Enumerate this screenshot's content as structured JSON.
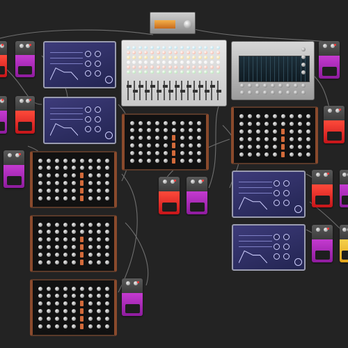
{
  "workspace": {
    "background": "#232323",
    "cable_color": "#7a7a7a"
  },
  "colors": {
    "pedal_magenta": "#b21fbf",
    "pedal_red": "#e1221f",
    "pedal_yellow": "#f1c21b",
    "pedal_teal": "#1bb6c9",
    "wood": "#8a4a2c",
    "synth_purple": "#3d3b7a",
    "display_orange": "#f0a040"
  },
  "devices": {
    "top_unit": {
      "title": "",
      "icon": "amp-unit-icon"
    },
    "pedals": [
      {
        "id": "pedal-1",
        "color": "red",
        "label": ""
      },
      {
        "id": "pedal-2",
        "color": "magenta",
        "label": ""
      },
      {
        "id": "pedal-3",
        "color": "magenta",
        "label": ""
      },
      {
        "id": "pedal-4",
        "color": "red",
        "label": ""
      },
      {
        "id": "pedal-5",
        "color": "magenta",
        "label": ""
      },
      {
        "id": "pedal-6",
        "color": "red",
        "label": ""
      },
      {
        "id": "pedal-7",
        "color": "magenta",
        "label": ""
      },
      {
        "id": "pedal-8",
        "color": "magenta",
        "label": ""
      },
      {
        "id": "pedal-9",
        "color": "magenta",
        "label": ""
      },
      {
        "id": "pedal-10",
        "color": "red",
        "label": ""
      },
      {
        "id": "pedal-11",
        "color": "red",
        "label": ""
      },
      {
        "id": "pedal-12",
        "color": "magenta",
        "label": ""
      },
      {
        "id": "pedal-13",
        "color": "magenta",
        "label": ""
      },
      {
        "id": "pedal-14",
        "color": "yellow",
        "label": ""
      }
    ],
    "synths": [
      {
        "id": "synth-1",
        "title": ""
      },
      {
        "id": "synth-2",
        "title": ""
      },
      {
        "id": "synth-3",
        "title": ""
      },
      {
        "id": "synth-4",
        "title": ""
      }
    ],
    "wood_modules": [
      {
        "id": "module-1",
        "title": ""
      },
      {
        "id": "module-2",
        "title": ""
      },
      {
        "id": "module-3",
        "title": ""
      },
      {
        "id": "module-4",
        "title": ""
      },
      {
        "id": "module-5",
        "title": ""
      }
    ],
    "mixer": {
      "channels": 16
    },
    "sequencer": {
      "title": ""
    }
  }
}
